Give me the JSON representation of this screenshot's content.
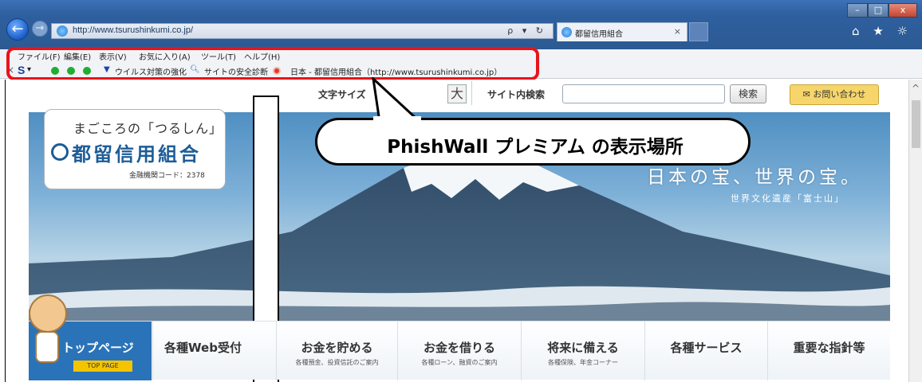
{
  "browser": {
    "url": "http://www.tsurushinkumi.co.jp/",
    "address_controls": "ρ ▾ ↻",
    "tab_title": "都留信用組合",
    "tab_close": "×",
    "nav_back": "←",
    "nav_forward": "→",
    "window_controls": {
      "minimize": "–",
      "maximize": "□",
      "close": "x"
    },
    "chrome_icons": "⌂ ★ ☼"
  },
  "menubar": {
    "items": [
      "ファイル(F)",
      "編集(E)",
      "表示(V)",
      "お気に入り(A)",
      "ツール(T)",
      "ヘルプ(H)"
    ]
  },
  "toolbar": {
    "close": "×",
    "s_label": "S",
    "s_arrow": "▾",
    "virus": "ウイルス対策の強化",
    "safety": "サイトの安全診断",
    "site_info": "日本 - 都留信用組合（http://www.tsurushinkumi.co.jp）"
  },
  "callout": {
    "text": "PhishWall プレミアム の表示場所"
  },
  "utility": {
    "font_size_label": "文字サイズ",
    "font_size_large": "大",
    "site_search_label": "サイト内検索",
    "search_placeholder": "",
    "search_button": "検索",
    "contact_button": "お問い合わせ",
    "contact_icon": "✉"
  },
  "logo": {
    "tagline": "まごころの「つるしん」",
    "name": "都留信用組合",
    "code": "金融機関コード：2378"
  },
  "hero": {
    "copy": "日本の宝、世界の宝。",
    "sub": "世界文化遺産「富士山」"
  },
  "nav": {
    "top_page": "トップページ",
    "top_page_badge": "TOP PAGE",
    "items": [
      {
        "main": "各種Web受付",
        "sub": ""
      },
      {
        "main": "お金を貯める",
        "sub": "各種預金、投資信託のご案内"
      },
      {
        "main": "お金を借りる",
        "sub": "各種ローン、融資のご案内"
      },
      {
        "main": "将来に備える",
        "sub": "各種保険、年金コーナー"
      },
      {
        "main": "各種サービス",
        "sub": ""
      },
      {
        "main": "重要な指針等",
        "sub": ""
      }
    ]
  },
  "scrollbar": {
    "up": "^"
  },
  "colors": {
    "highlight": "#e8141b",
    "brand": "#1d5c97",
    "accent": "#f6d66b"
  }
}
